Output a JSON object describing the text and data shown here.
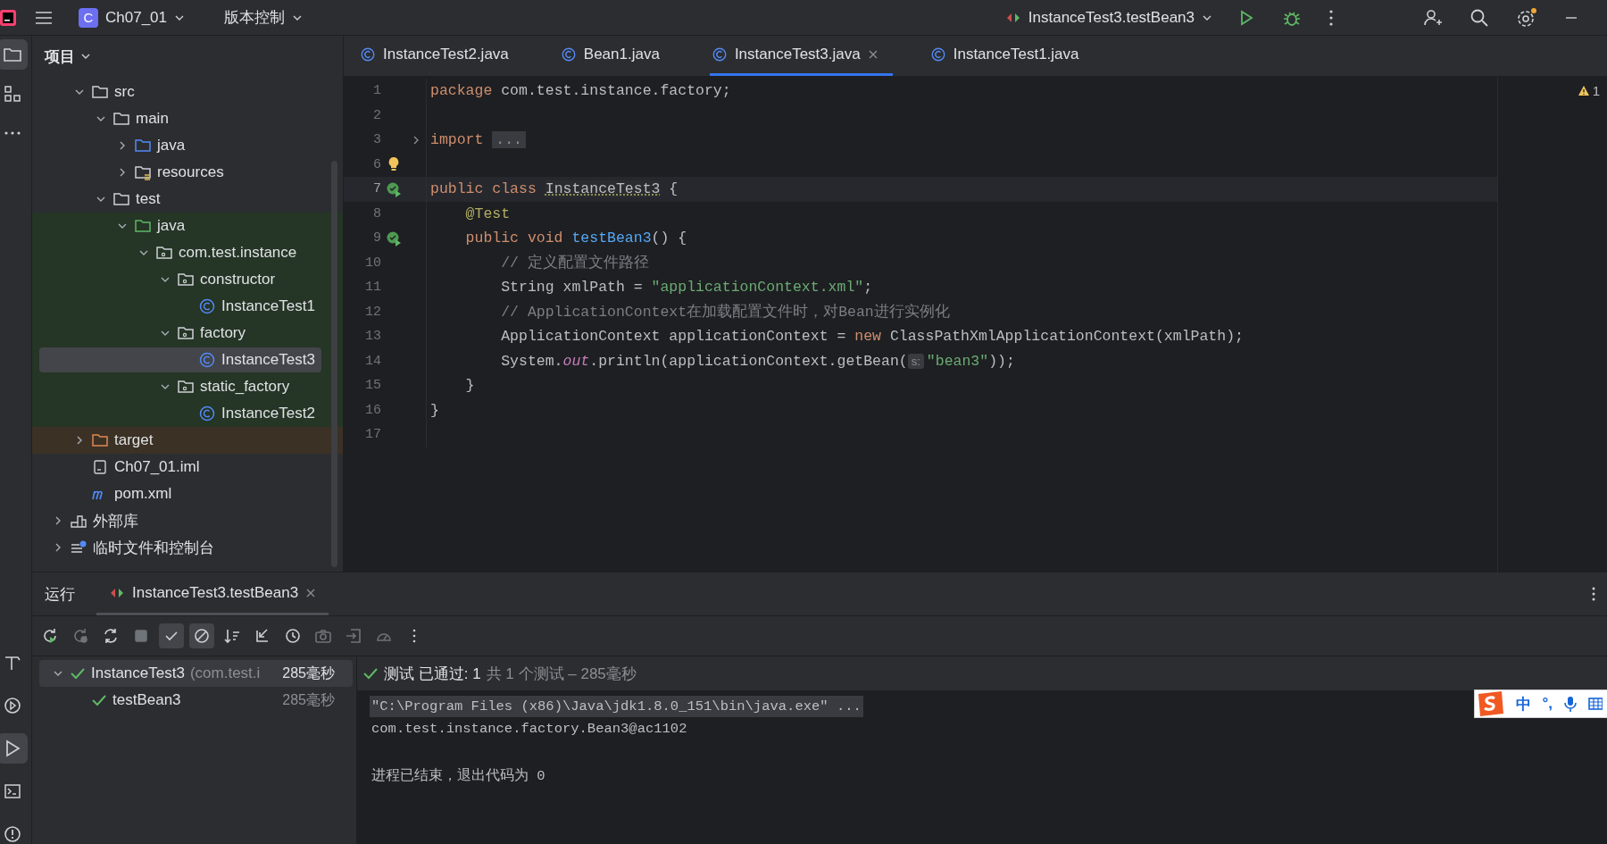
{
  "titlebar": {
    "project_letter": "C",
    "project": "Ch07_01",
    "vcs": "版本控制",
    "run_config": "InstanceTest3.testBean3"
  },
  "left_stripe": {
    "top": [
      {
        "kind": "project",
        "selected": true
      },
      {
        "kind": "structure",
        "selected": false
      },
      {
        "kind": "more",
        "selected": false
      }
    ],
    "bottom": [
      {
        "kind": "build",
        "selected": false
      },
      {
        "kind": "services",
        "selected": false
      },
      {
        "kind": "run",
        "selected": true
      },
      {
        "kind": "terminal",
        "selected": false
      },
      {
        "kind": "problems",
        "selected": false
      }
    ]
  },
  "project": {
    "title": "项目",
    "tree": [
      {
        "children": [
          {
            "label": "src",
            "kind": "folder",
            "expanded": true,
            "selected": false,
            "children": [
              {
                "label": "main",
                "kind": "folder",
                "expanded": true,
                "selected": false,
                "children": [
                  {
                    "label": "java",
                    "kind": "source-folder",
                    "expanded": false,
                    "selected": false
                  },
                  {
                    "label": "resources",
                    "kind": "resources-folder",
                    "expanded": false,
                    "selected": false
                  }
                ]
              },
              {
                "label": "test",
                "kind": "folder",
                "expanded": true,
                "selected": false,
                "children": [
                  {
                    "label": "java",
                    "kind": "test-folder",
                    "expanded": true,
                    "selected": false,
                    "children": [
                      {
                        "label": "com.test.instance",
                        "kind": "package",
                        "expanded": true,
                        "selected": false,
                        "children": [
                          {
                            "label": "constructor",
                            "kind": "package",
                            "expanded": true,
                            "selected": false,
                            "children": [
                              {
                                "label": "InstanceTest1",
                                "kind": "class",
                                "selected": false
                              }
                            ]
                          },
                          {
                            "label": "factory",
                            "kind": "package",
                            "expanded": true,
                            "selected": false,
                            "children": [
                              {
                                "label": "InstanceTest3",
                                "kind": "class",
                                "selected": true
                              }
                            ]
                          },
                          {
                            "label": "static_factory",
                            "kind": "package",
                            "expanded": true,
                            "selected": false,
                            "children": [
                              {
                                "label": "InstanceTest2",
                                "kind": "class",
                                "selected": false
                              }
                            ]
                          }
                        ]
                      }
                    ]
                  }
                ]
              }
            ]
          },
          {
            "label": "target",
            "kind": "excluded-folder",
            "expanded": false,
            "selected": false
          },
          {
            "label": "Ch07_01.iml",
            "kind": "iml",
            "selected": false
          },
          {
            "label": "pom.xml",
            "kind": "maven",
            "selected": false
          }
        ]
      },
      {
        "label": "外部库",
        "kind": "library",
        "expanded": false,
        "selected": false
      },
      {
        "label": "临时文件和控制台",
        "kind": "scratches",
        "expanded": false,
        "selected": false
      }
    ]
  },
  "editor": {
    "tabs": [
      {
        "label": "InstanceTest2.java",
        "selected": false,
        "closable": false
      },
      {
        "label": "Bean1.java",
        "selected": false,
        "closable": false
      },
      {
        "label": "InstanceTest3.java",
        "selected": true,
        "closable": true
      },
      {
        "label": "InstanceTest1.java",
        "selected": false,
        "closable": false
      }
    ],
    "warnings": "1",
    "lines": [
      {
        "number": "1",
        "tokens": [
          {
            "kind": "kw",
            "text": "package "
          },
          {
            "kind": "plain",
            "text": "com.test.instance.factory;"
          }
        ]
      },
      {
        "number": "2"
      },
      {
        "number": "3",
        "fold": true,
        "tokens": [
          {
            "kind": "kw",
            "text": "import "
          },
          {
            "kind": "folded",
            "text": "..."
          }
        ]
      },
      {
        "number": "6",
        "gutter": {
          "kind": "bulb"
        }
      },
      {
        "number": "7",
        "gutter": {
          "kind": "run"
        },
        "current": true,
        "tokens": [
          {
            "kind": "kw",
            "text": "public class "
          },
          {
            "kind": "decl",
            "text": "InstanceTest3"
          },
          {
            "kind": "plain",
            "text": " {"
          }
        ]
      },
      {
        "number": "8",
        "tokens": [
          {
            "kind": "anno",
            "text": "    @Test"
          }
        ]
      },
      {
        "number": "9",
        "gutter": {
          "kind": "run"
        },
        "tokens": [
          {
            "kind": "kw",
            "text": "    public void "
          },
          {
            "kind": "fn",
            "text": "testBean3"
          },
          {
            "kind": "plain",
            "text": "() {"
          }
        ]
      },
      {
        "number": "10",
        "tokens": [
          {
            "kind": "comment",
            "text": "        // 定义配置文件路径"
          }
        ]
      },
      {
        "number": "11",
        "tokens": [
          {
            "kind": "plain",
            "text": "        String xmlPath = "
          },
          {
            "kind": "str",
            "text": "\"applicationContext.xml\""
          },
          {
            "kind": "plain",
            "text": ";"
          }
        ]
      },
      {
        "number": "12",
        "tokens": [
          {
            "kind": "comment",
            "text": "        // ApplicationContext在加载配置文件时，对Bean进行实例化"
          }
        ]
      },
      {
        "number": "13",
        "tokens": [
          {
            "kind": "plain",
            "text": "        ApplicationContext applicationContext = "
          },
          {
            "kind": "kw",
            "text": "new"
          },
          {
            "kind": "plain",
            "text": " ClassPathXmlApplicationContext(xmlPath);"
          }
        ]
      },
      {
        "number": "14",
        "tokens": [
          {
            "kind": "plain",
            "text": "        System."
          },
          {
            "kind": "static",
            "text": "out"
          },
          {
            "kind": "plain",
            "text": ".println(applicationContext.getBean("
          },
          {
            "kind": "hint",
            "text": "s:"
          },
          {
            "kind": "str",
            "text": "\"bean3\""
          },
          {
            "kind": "plain",
            "text": "));"
          }
        ]
      },
      {
        "number": "15",
        "tokens": [
          {
            "kind": "plain",
            "text": "    }"
          }
        ]
      },
      {
        "number": "16",
        "tokens": [
          {
            "kind": "plain",
            "text": "}"
          }
        ]
      },
      {
        "number": "17"
      }
    ]
  },
  "run_panel": {
    "title": "运行",
    "tab": {
      "label": "InstanceTest3.testBean3"
    },
    "toolbar": [
      {
        "kind": "rerun",
        "selected": false,
        "disabled": false
      },
      {
        "kind": "rerun-failed",
        "selected": false,
        "disabled": true
      },
      {
        "kind": "auto-test",
        "selected": false,
        "disabled": false
      },
      {
        "kind": "stop",
        "selected": false,
        "disabled": true
      },
      {
        "kind": "show-passed",
        "selected": true,
        "disabled": false
      },
      {
        "kind": "show-ignored",
        "selected": true,
        "disabled": false
      },
      {
        "kind": "sort",
        "selected": false,
        "disabled": false
      },
      {
        "kind": "collapse",
        "selected": false,
        "disabled": false
      },
      {
        "kind": "history",
        "selected": false,
        "disabled": false
      },
      {
        "kind": "camera",
        "selected": false,
        "disabled": true
      },
      {
        "kind": "export",
        "selected": false,
        "disabled": true
      },
      {
        "kind": "gauge",
        "selected": false,
        "disabled": true
      },
      {
        "kind": "more",
        "selected": false,
        "disabled": false
      }
    ],
    "tests": [
      {
        "name": "InstanceTest3",
        "detail": "(com.test.i",
        "time": "285毫秒",
        "passed": true,
        "expanded": true,
        "selected": true,
        "children": [
          {
            "name": "testBean3",
            "time": "285毫秒",
            "passed": true,
            "selected": false
          }
        ]
      }
    ],
    "status": {
      "passed": "测试 已通过: 1",
      "summary": "共 1 个测试 – 285毫秒"
    },
    "console": [
      {
        "text": "\"C:\\Program Files (x86)\\Java\\jdk1.8.0_151\\bin\\java.exe\" ...",
        "highlighted": true
      },
      {
        "text": "com.test.instance.factory.Bean3@ac1102",
        "highlighted": false
      },
      {
        "text": "进程已结束，退出代码为 0",
        "highlighted": false
      }
    ]
  },
  "ime": {
    "mode": "中",
    "punct": "°,"
  }
}
